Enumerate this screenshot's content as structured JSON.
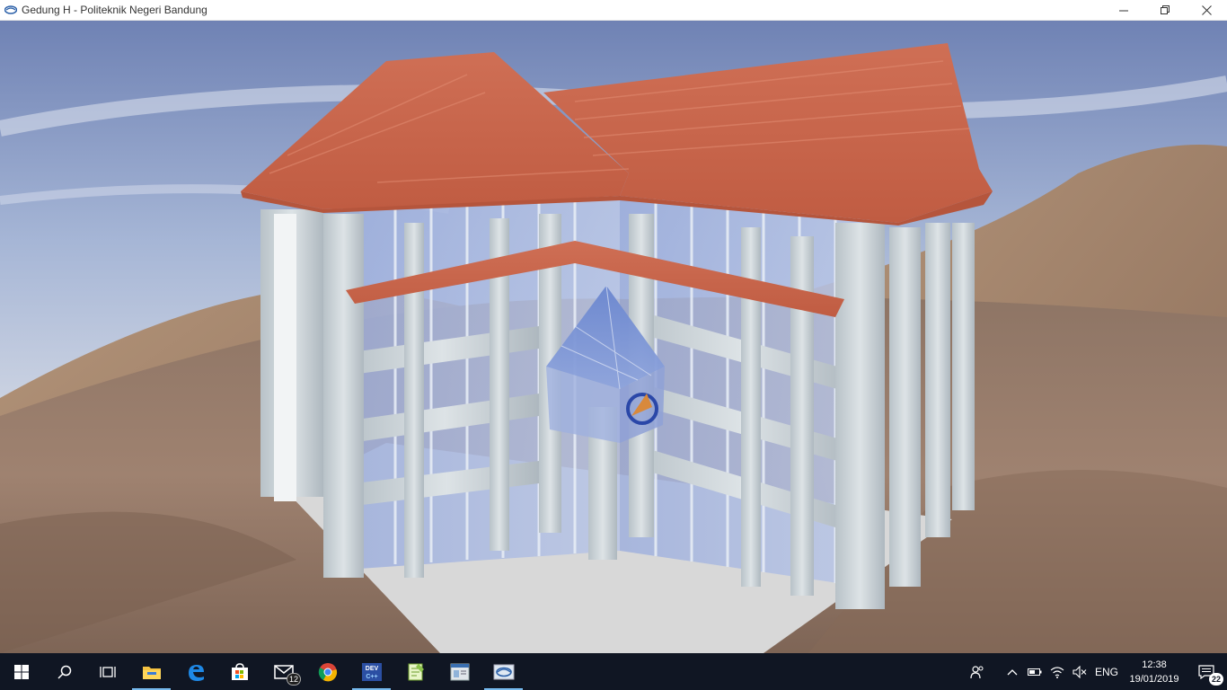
{
  "window": {
    "title": "Gedung H - Politeknik Negeri Bandung",
    "icon": "app-logo-icon",
    "controls": [
      "minimize-icon",
      "restore-icon",
      "close-icon"
    ]
  },
  "viewport": {
    "description_icon": "3d-scene",
    "roof_color": "#c8644a",
    "glass_color": "#8a9ed8",
    "column_color": "#c9d1d6",
    "floor_color": "#d9d9d9"
  },
  "taskbar": {
    "start_icon": "windows-start-icon",
    "search_icon": "search-icon",
    "taskview_icon": "task-view-icon",
    "apps": [
      {
        "name": "file-explorer",
        "active": true,
        "badge": ""
      },
      {
        "name": "edge",
        "active": false,
        "badge": ""
      },
      {
        "name": "store",
        "active": false,
        "badge": ""
      },
      {
        "name": "mail",
        "active": false,
        "badge": "12"
      },
      {
        "name": "chrome",
        "active": false,
        "badge": ""
      },
      {
        "name": "dev-cpp",
        "active": true,
        "badge": ""
      },
      {
        "name": "notepad-plus",
        "active": false,
        "badge": ""
      },
      {
        "name": "window-app",
        "active": false,
        "badge": ""
      },
      {
        "name": "polban-app",
        "active": true,
        "badge": ""
      }
    ],
    "tray": {
      "language": "ENG",
      "time": "12:38",
      "date": "19/01/2019",
      "notifications": "22"
    }
  }
}
